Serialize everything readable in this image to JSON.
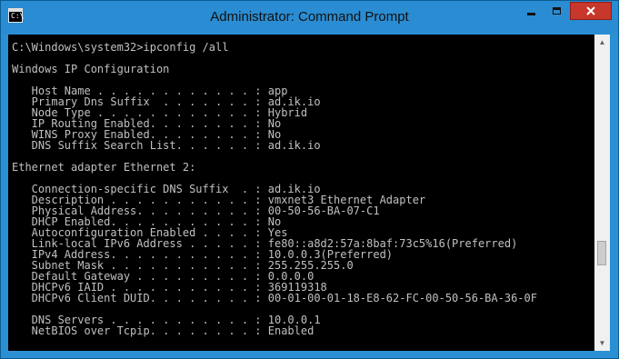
{
  "window": {
    "title": "Administrator: Command Prompt",
    "icon_label": "C:\\"
  },
  "console": {
    "lines": [
      "C:\\Windows\\system32>ipconfig /all",
      "",
      "Windows IP Configuration",
      "",
      "   Host Name . . . . . . . . . . . . : app",
      "   Primary Dns Suffix  . . . . . . . : ad.ik.io",
      "   Node Type . . . . . . . . . . . . : Hybrid",
      "   IP Routing Enabled. . . . . . . . : No",
      "   WINS Proxy Enabled. . . . . . . . : No",
      "   DNS Suffix Search List. . . . . . : ad.ik.io",
      "",
      "Ethernet adapter Ethernet 2:",
      "",
      "   Connection-specific DNS Suffix  . : ad.ik.io",
      "   Description . . . . . . . . . . . : vmxnet3 Ethernet Adapter",
      "   Physical Address. . . . . . . . . : 00-50-56-BA-07-C1",
      "   DHCP Enabled. . . . . . . . . . . : No",
      "   Autoconfiguration Enabled . . . . : Yes",
      "   Link-local IPv6 Address . . . . . : fe80::a8d2:57a:8baf:73c5%16(Preferred)",
      "   IPv4 Address. . . . . . . . . . . : 10.0.0.3(Preferred)",
      "   Subnet Mask . . . . . . . . . . . : 255.255.255.0",
      "   Default Gateway . . . . . . . . . : 0.0.0.0",
      "   DHCPv6 IAID . . . . . . . . . . . : 369119318",
      "   DHCPv6 Client DUID. . . . . . . . : 00-01-00-01-18-E8-62-FC-00-50-56-BA-36-0F",
      "",
      "   DNS Servers . . . . . . . . . . . : 10.0.0.1",
      "   NetBIOS over Tcpip. . . . . . . . : Enabled"
    ]
  },
  "colors": {
    "titlebar": "#2a8cd2",
    "console_bg": "#000000",
    "console_text": "#c0c0c0",
    "close_button": "#c7372b"
  }
}
